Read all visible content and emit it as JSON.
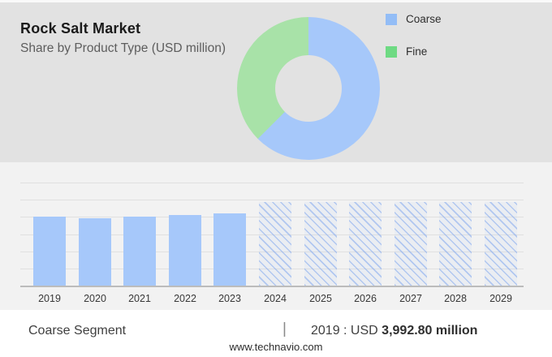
{
  "header": {
    "title": "Rock Salt Market",
    "subtitle": "Share by Product Type (USD million)"
  },
  "legend": {
    "items": [
      {
        "label": "Coarse",
        "color": "#93bdf6"
      },
      {
        "label": "Fine",
        "color": "#6eda83"
      }
    ]
  },
  "colors": {
    "top_background": "#e2e2e2",
    "chart_background": "#f2f2f2",
    "bar_blue": "#a6c8fa",
    "donut_blue": "#a6c8fa",
    "donut_green": "#a8e2a8",
    "gridline": "#e0e0e0",
    "baseline": "#bcbcbc"
  },
  "chart_data": [
    {
      "type": "pie",
      "variant": "donut",
      "title": "Rock Salt Market — Share by Product Type (USD million)",
      "labels": [
        "Coarse",
        "Fine"
      ],
      "values_pct": [
        62.5,
        37.5
      ],
      "colors": [
        "#a6c8fa",
        "#a8e2a8"
      ],
      "start_angle_deg": 0,
      "direction": "clockwise",
      "legend_position": "right",
      "note": "No numeric labels shown; shares estimated from arc angles (blue Coarse ~62.5%, green Fine ~37.5%)."
    },
    {
      "type": "bar",
      "categories": [
        "2019",
        "2020",
        "2021",
        "2022",
        "2023",
        "2024",
        "2025",
        "2026",
        "2027",
        "2028",
        "2029"
      ],
      "series": [
        {
          "name": "Coarse segment value (USD million)",
          "values": [
            3992.8,
            3940,
            4010,
            4120,
            4220,
            4860,
            4860,
            4860,
            4860,
            4860,
            4860
          ]
        }
      ],
      "forecast_from_index": 5,
      "forecast_style": "diagonal-hatch",
      "ylim": [
        0,
        6000
      ],
      "gridline_step": 1000,
      "y_tick_labels_shown": false,
      "grid": "horizontal",
      "xlabel": "",
      "ylabel": "",
      "anchor_value_note": "2019 value 3,992.80 shown in footer; other values estimated from bar heights vs gridlines."
    }
  ],
  "footer": {
    "segment_label": "Coarse Segment",
    "divider": "|",
    "value_prefix": "2019 : USD",
    "value_bold": "3,992.80 million",
    "website": "www.technavio.com"
  }
}
